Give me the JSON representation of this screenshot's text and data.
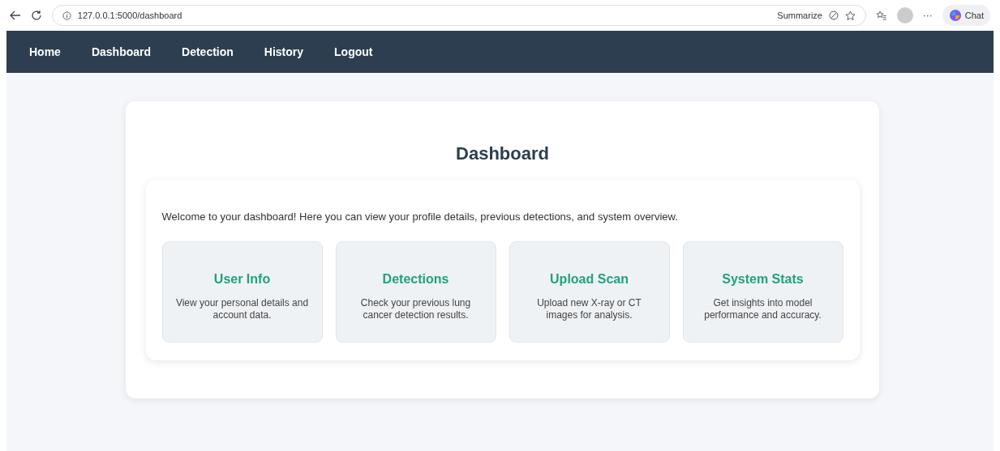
{
  "browser": {
    "url": "127.0.0.1:5000/dashboard",
    "summarize": "Summarize",
    "more": "···",
    "chat": "Chat"
  },
  "nav": [
    {
      "label": "Home"
    },
    {
      "label": "Dashboard"
    },
    {
      "label": "Detection"
    },
    {
      "label": "History"
    },
    {
      "label": "Logout"
    }
  ],
  "title": "Dashboard",
  "welcome": "Welcome to your dashboard! Here you can view your profile details, previous detections, and system overview.",
  "cards": [
    {
      "title": "User Info",
      "text": "View your personal details and account data."
    },
    {
      "title": "Detections",
      "text": "Check your previous lung cancer detection results."
    },
    {
      "title": "Upload Scan",
      "text": "Upload new X-ray or CT images for analysis."
    },
    {
      "title": "System Stats",
      "text": "Get insights into model performance and accuracy."
    }
  ]
}
